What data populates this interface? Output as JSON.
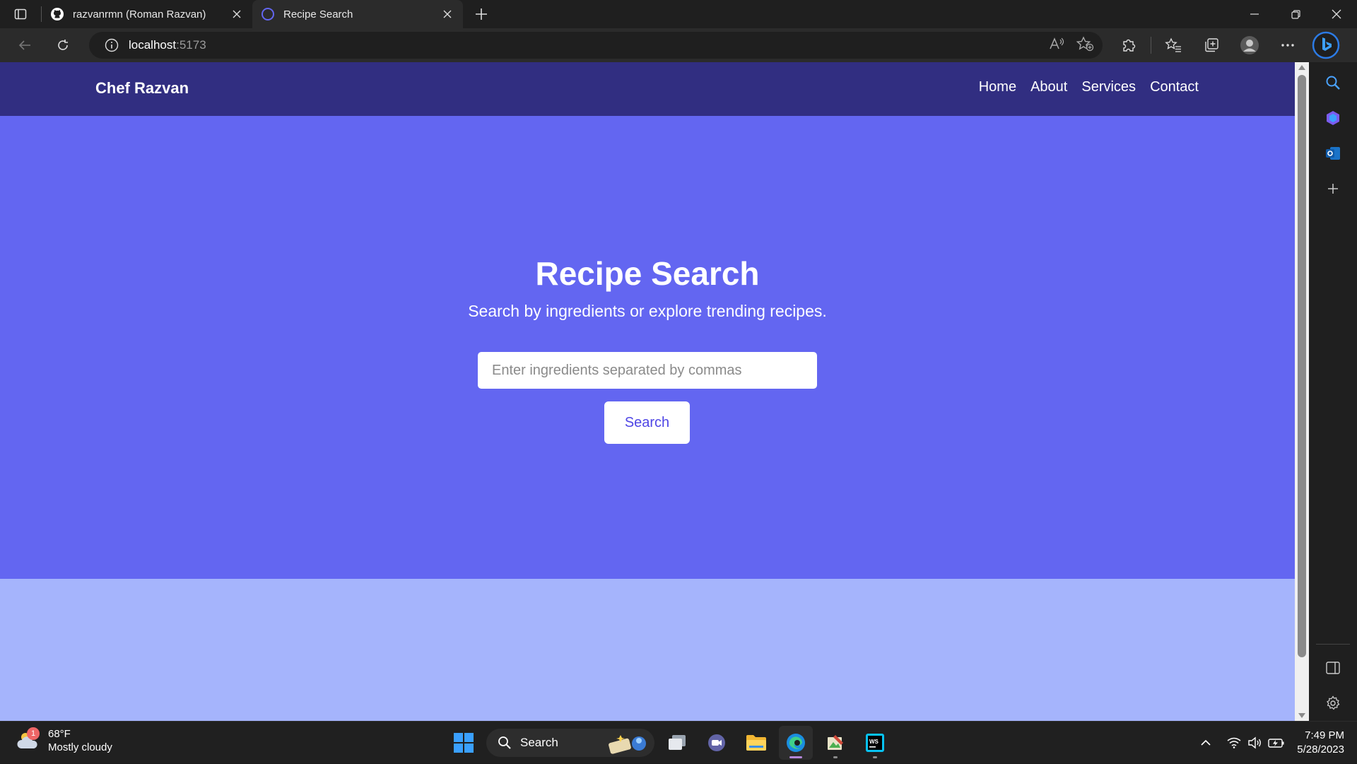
{
  "browser": {
    "tabs": [
      {
        "title": "razvanrmn (Roman Razvan)",
        "icon": "github-icon",
        "active": false
      },
      {
        "title": "Recipe Search",
        "icon": "loading-circle-icon",
        "active": true
      }
    ],
    "url_host": "localhost",
    "url_port": ":5173"
  },
  "site": {
    "brand": "Chef Razvan",
    "nav": [
      "Home",
      "About",
      "Services",
      "Contact"
    ]
  },
  "hero": {
    "title": "Recipe Search",
    "subtitle": "Search by ingredients or explore trending recipes.",
    "input_placeholder": "Enter ingredients separated by commas",
    "input_value": "",
    "button_label": "Search"
  },
  "taskbar": {
    "weather_temp": "68°F",
    "weather_desc": "Mostly cloudy",
    "weather_badge": "1",
    "search_label": "Search",
    "time": "7:49 PM",
    "date": "5/28/2023"
  },
  "colors": {
    "nav_bg": "#312e81",
    "hero_bg": "#6366f1",
    "page_bg": "#a5b4fc",
    "button_text": "#4f46e5"
  }
}
